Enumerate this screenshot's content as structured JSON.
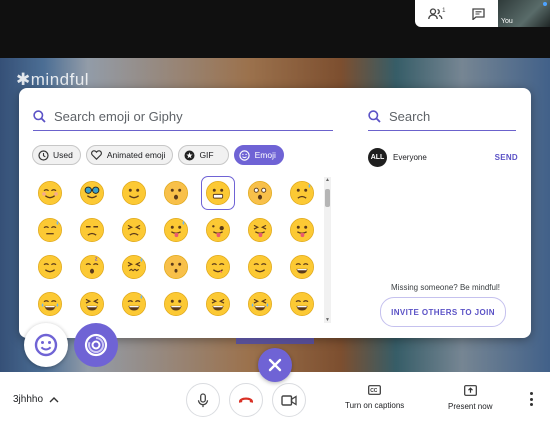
{
  "top": {
    "participants_count": "1",
    "self_label": "You"
  },
  "background": {
    "watermark": "mindful"
  },
  "panel": {
    "search_placeholder": "Search emoji or Giphy",
    "chips": [
      {
        "label": "Used",
        "icon": "clock-icon",
        "active": false
      },
      {
        "label": "Animated emoji",
        "icon": "heart-icon",
        "active": false
      },
      {
        "label": "GIF",
        "icon": "gif-icon",
        "active": false
      },
      {
        "label": "Emoji",
        "icon": "smiley-icon",
        "active": true
      }
    ],
    "emojis": [
      "blush",
      "sunglasses-nerd",
      "slight-smile",
      "hushed",
      "grimacing",
      "scared",
      "disappointed-relieved",
      "downcast-sweat",
      "unamused",
      "weary",
      "hot",
      "zany",
      "stuck-out-tongue",
      "tongue",
      "relieved",
      "sleeping",
      "confounded",
      "hushed-small",
      "yum",
      "smiling",
      "grin-wide",
      "joy-tears",
      "laughing",
      "grin-sweat",
      "grin",
      "squint-laugh",
      "rofl",
      "beaming"
    ],
    "selected_emoji_index": 4,
    "chat": {
      "search_placeholder": "Search",
      "recipient_avatar": "ALL",
      "recipient": "Everyone",
      "send_label": "SEND",
      "missing_text": "Missing someone? Be mindful!",
      "invite_label": "INVITE OTHERS TO JOIN"
    }
  },
  "bottom": {
    "meeting_code": "3jhhho",
    "captions_label": "Turn on captions",
    "present_label": "Present now"
  },
  "colors": {
    "accent": "#6f63d5",
    "end_call": "#d93025",
    "emoji_yellow": "#fcc934"
  }
}
